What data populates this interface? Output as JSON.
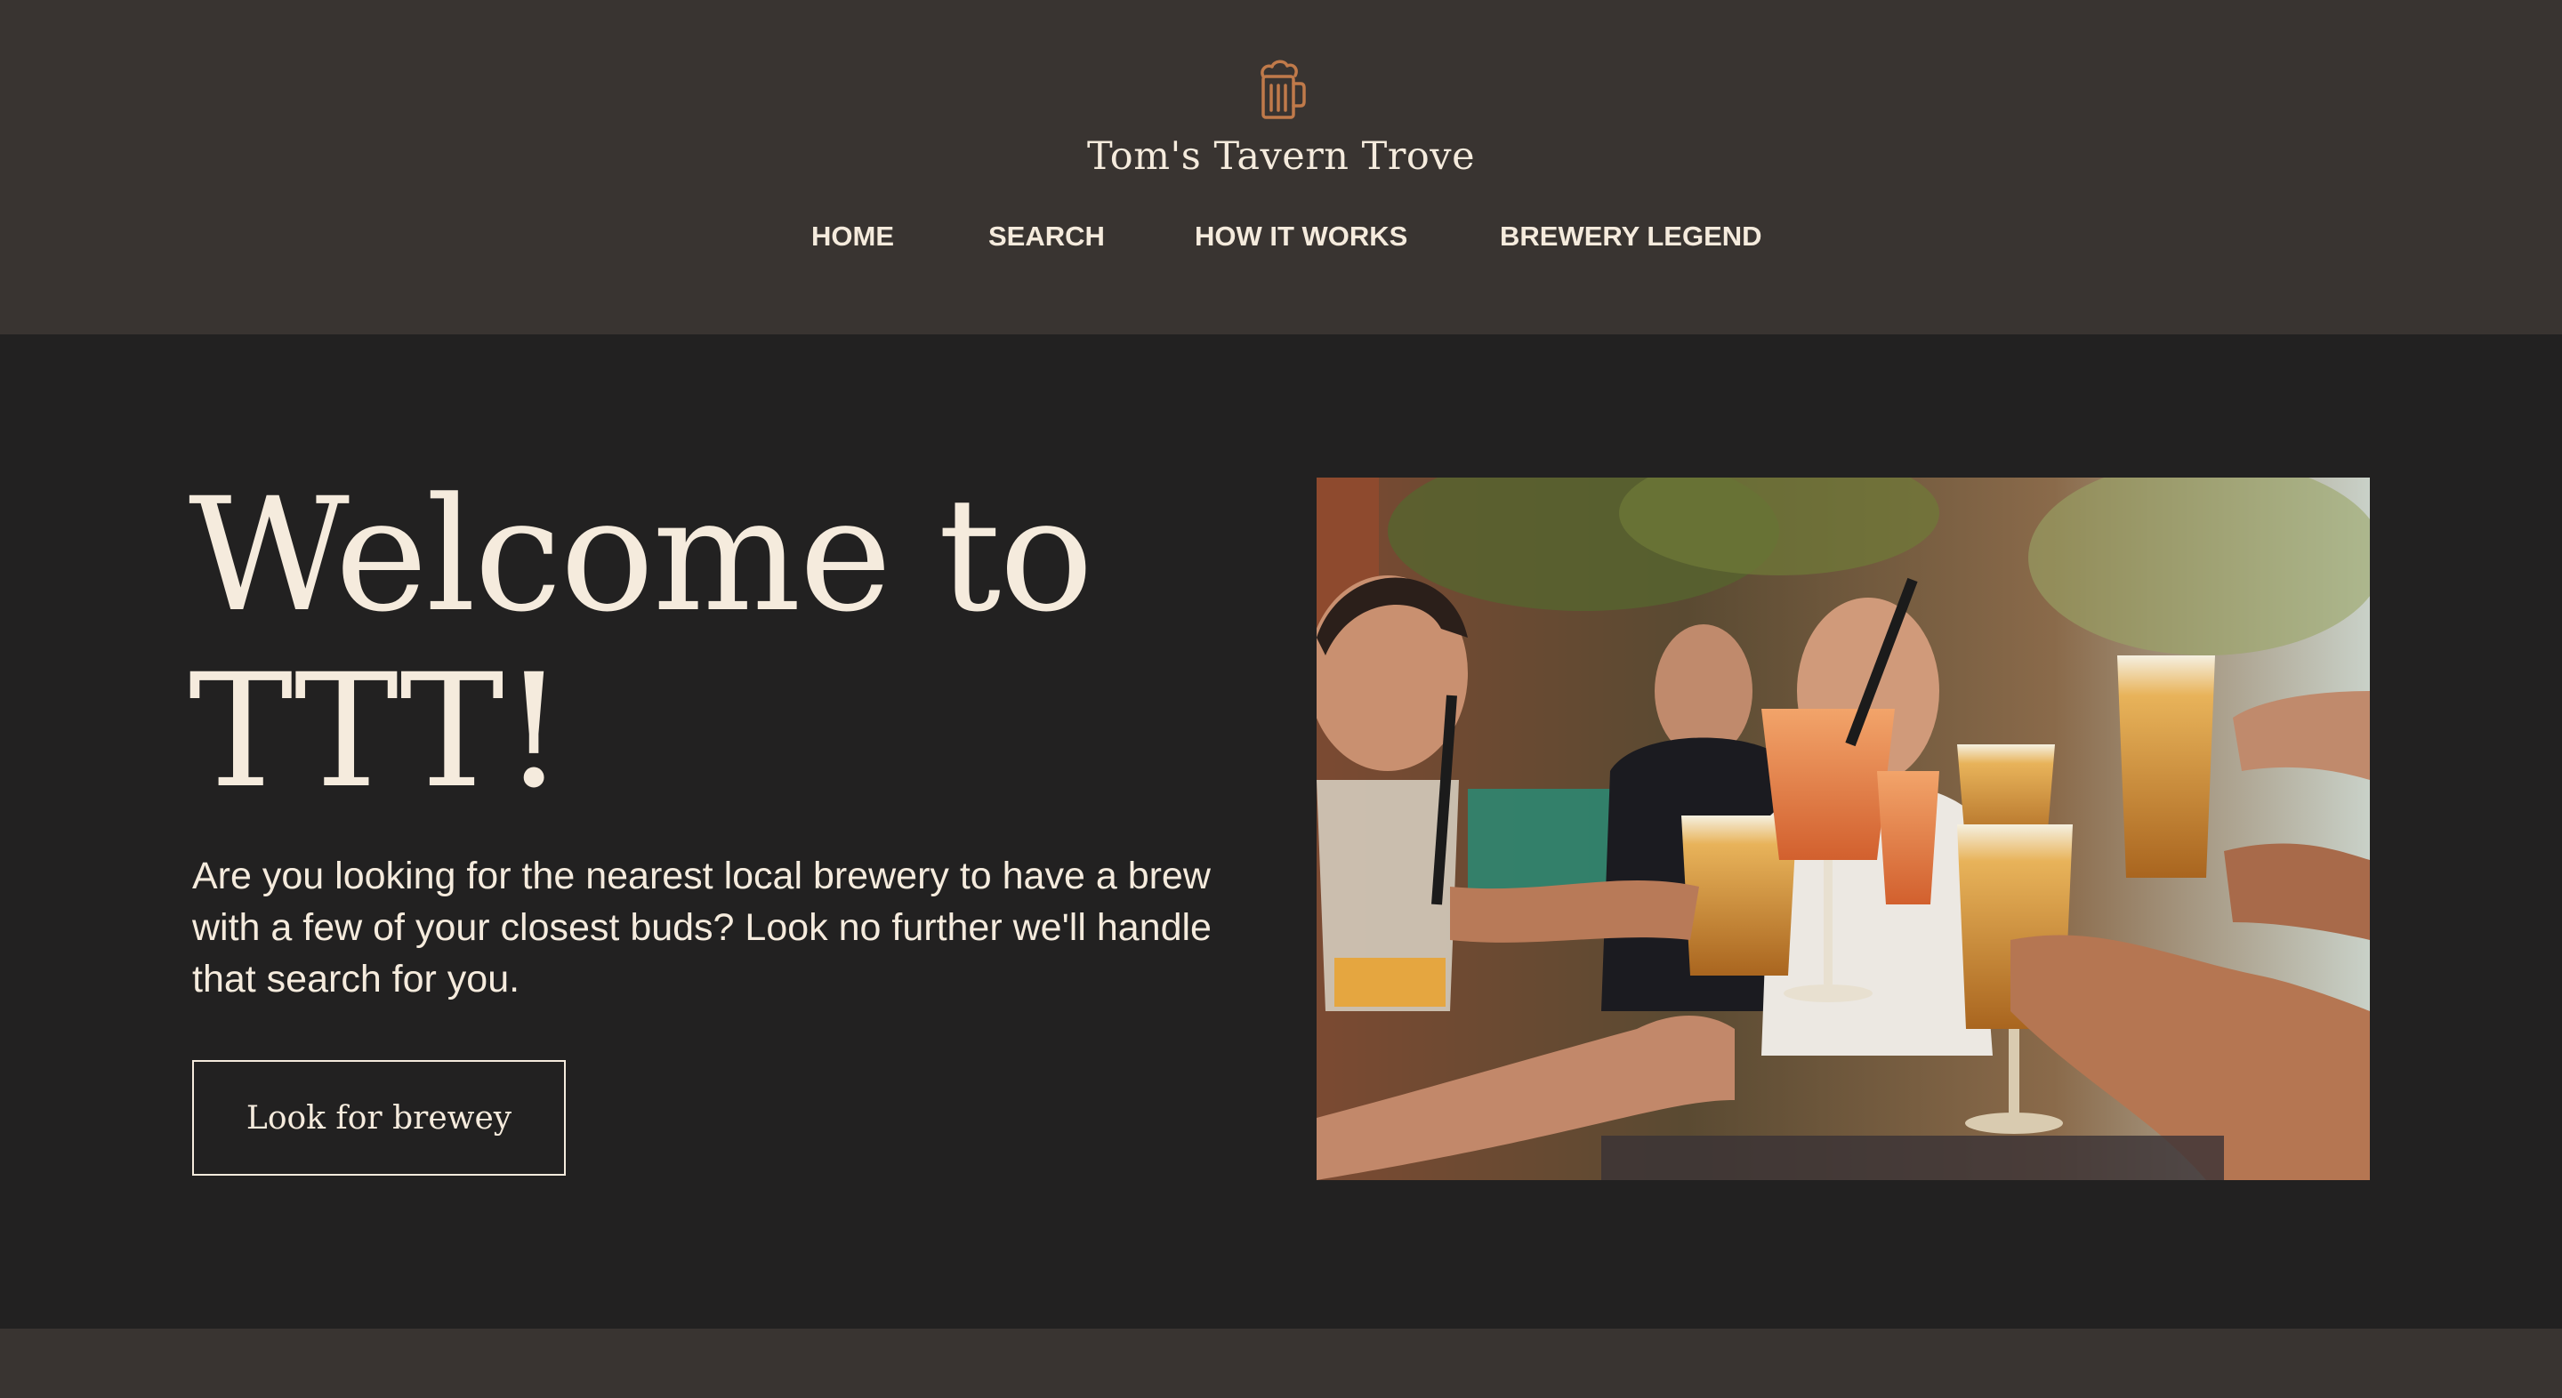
{
  "header": {
    "logo_icon": "beer-mug-icon",
    "title": "Tom's Tavern Trove",
    "nav": [
      {
        "label": "HOME"
      },
      {
        "label": "SEARCH"
      },
      {
        "label": "HOW IT WORKS"
      },
      {
        "label": "BREWERY LEGEND"
      }
    ]
  },
  "hero": {
    "title": "Welcome to TTT!",
    "description": "Are you looking for the nearest local brewery to have a brew with a few of your closest buds? Look no further we'll handle that search for you.",
    "button_label": "Look for brewey",
    "image_icon": "friends-toasting-beers-photo"
  },
  "colors": {
    "header_bg": "#393431",
    "hero_bg": "#222121",
    "text": "#f5ebdd",
    "logo_accent": "#c07a4a"
  }
}
